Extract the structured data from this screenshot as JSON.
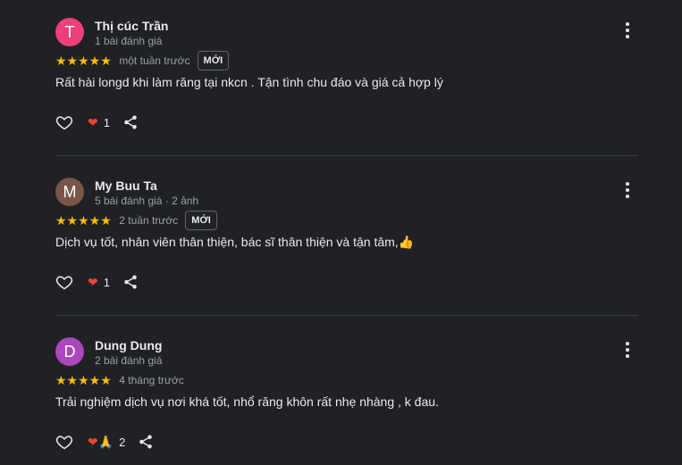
{
  "reviews": [
    {
      "initial": "T",
      "avatar_color": "#ec407a",
      "name": "Thị cúc Trần",
      "meta": "1 bài đánh giá",
      "stars": "★★★★★",
      "time": "một tuần trước",
      "badge": "MỚI",
      "text": "Rất hài longd khi làm răng tại nkcn . Tận tình chu đáo và giá cả hợp lý",
      "reactions": "❤",
      "reaction_count": "1"
    },
    {
      "initial": "M",
      "avatar_color": "#795548",
      "name": "My Buu Ta",
      "meta": "5 bài đánh giá · 2 ảnh",
      "stars": "★★★★★",
      "time": "2 tuần trước",
      "badge": "MỚI",
      "text": "Dịch vụ tốt, nhân viên thân thiện, bác sĩ thân thiện và tận tâm,👍",
      "reactions": "❤",
      "reaction_count": "1"
    },
    {
      "initial": "D",
      "avatar_color": "#ab47bc",
      "name": "Dung Dung",
      "meta": "2 bài đánh giá",
      "stars": "★★★★★",
      "time": "4 tháng trước",
      "badge": "",
      "text": "Trải nghiệm dịch vụ nơi khá tốt, nhổ răng khôn rất nhẹ nhàng , k đau.",
      "reactions": "❤🙏",
      "reaction_count": "2"
    }
  ],
  "icons": {
    "like": "heart-outline-icon",
    "share": "share-icon",
    "more": "more-vert-icon"
  },
  "colors": {
    "background": "#202124",
    "star": "#fbbc04",
    "heart": "#ea4335",
    "divider": "#3c4043"
  }
}
